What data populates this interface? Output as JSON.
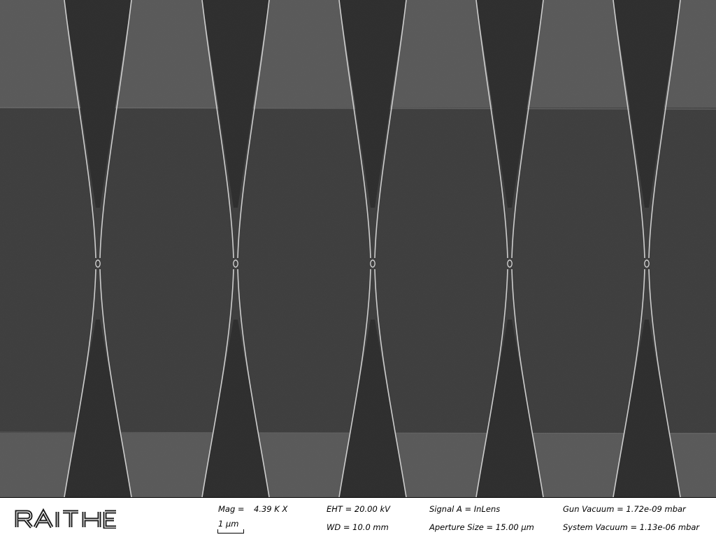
{
  "micrograph": {
    "structure_count": 5
  },
  "info_bar": {
    "logo_text": "RAITH",
    "magnification_label": "Mag =",
    "magnification_value": "4.39 K X",
    "scale_bar_label": "1 µm",
    "eht": "EHT = 20.00 kV",
    "wd": "WD = 10.0 mm",
    "signal": "Signal A = InLens",
    "aperture": "Aperture Size = 15.00 µm",
    "gun_vacuum": "Gun Vacuum = 1.72e-09 mbar",
    "system_vacuum": "System Vacuum = 1.13e-06 mbar"
  },
  "colors": {
    "substrate_dark": "#353535",
    "substrate_light": "#555555",
    "film_dark": "#232323",
    "edge_bright": "#d8d8d8",
    "info_bar_bg": "#ffffff"
  }
}
